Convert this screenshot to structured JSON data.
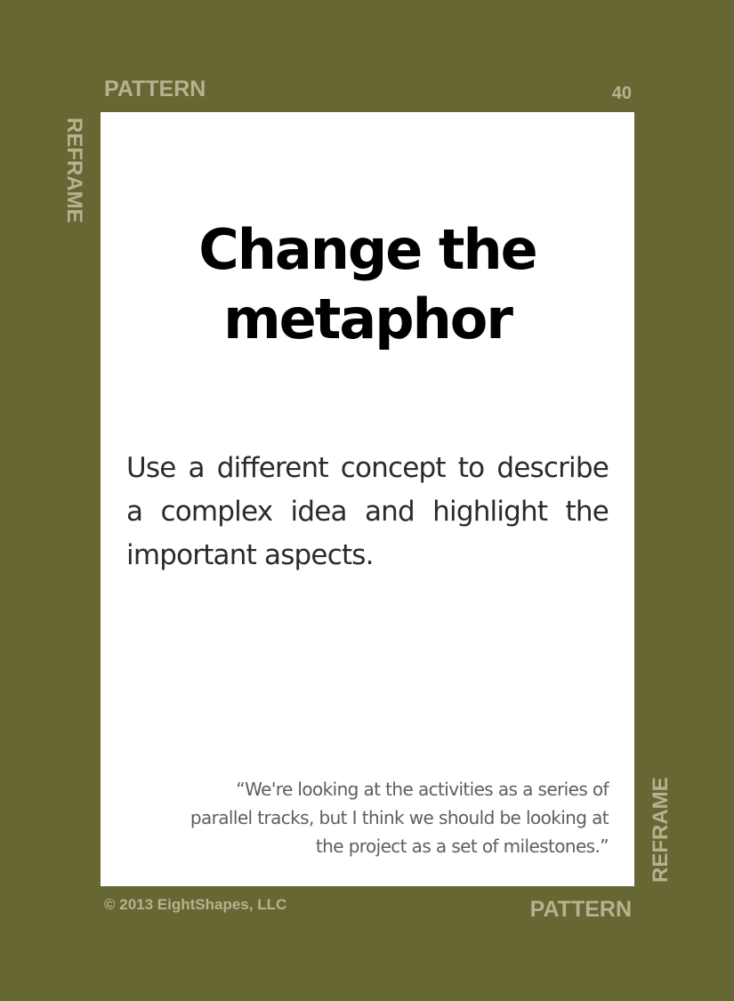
{
  "card": {
    "category_top": "PATTERN",
    "category_bottom": "PATTERN",
    "number": "40",
    "side_label_left": "REFRAME",
    "side_label_right": "REFRAME",
    "title_line1": "Change the",
    "title_line2": "metaphor",
    "description": "Use a different concept to describe a complex idea and highlight the important aspects.",
    "quote_line1": "“We're looking at the activities as a series of",
    "quote_line2": "parallel tracks, but I think we should be looking at",
    "quote_line3": "the project as a set of milestones.”",
    "copyright": "© 2013 EightShapes, LLC"
  },
  "colors": {
    "background": "#676733",
    "label": "#b3b391",
    "panel": "#ffffff",
    "title": "#000000",
    "description": "#2b2b2b",
    "quote": "#5e5e5e"
  }
}
